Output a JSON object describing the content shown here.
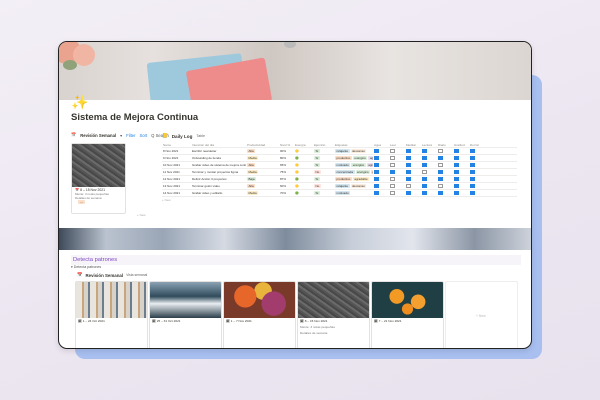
{
  "page": {
    "icon": "✨",
    "title": "Sistema de Mejora Continua"
  },
  "top_view": {
    "name": "Revisión Semanal",
    "filter": "Filter",
    "sort": "Sort",
    "search": "Q Search",
    "card": {
      "date": "📅 8 – 15 Nov 2021",
      "line1": "Mente: 3 notas pequeñas",
      "line2": "Detalles de semana",
      "tag": "—"
    },
    "add_new": "+ New"
  },
  "daily_log": {
    "title": "Daily Log",
    "view": "Table",
    "columns": [
      "Name",
      "Intención del día",
      "Productividad",
      "Nivel %",
      "Energía",
      "Ejercicio",
      "Etiquetas",
      "Agua",
      "Leer",
      "Meditar",
      "Lectura",
      "Diario",
      "Gratitud",
      "Dormir"
    ],
    "rows": [
      {
        "name": "8 Nov 2021",
        "intent": "Escribir newsletter",
        "prod": "Alta",
        "pct": "90%",
        "energy": "🟡",
        "ex": "Sí",
        "tags": [
          [
            "relajante",
            "#d3e5ef"
          ],
          [
            "descanso",
            "#fbecdd"
          ]
        ],
        "cb": [
          1,
          0,
          1,
          1,
          0,
          1,
          1
        ]
      },
      {
        "name": "9 Nov 2021",
        "intent": "Onboarding de tienda",
        "prod": "Media",
        "pct": "80%",
        "energy": "🟢",
        "ex": "Sí",
        "tags": [
          [
            "productivo",
            "#fadec9"
          ],
          [
            "enérgico",
            "#dbeddb"
          ],
          [
            "agradecido",
            "#e8deee"
          ]
        ],
        "cb": [
          1,
          0,
          1,
          1,
          1,
          1,
          1
        ]
      },
      {
        "name": "10 Nov 2021",
        "intent": "Grabar video de sistema de mejora continua",
        "prod": "Alta",
        "pct": "65%",
        "energy": "🟡",
        "ex": "Sí",
        "tags": [
          [
            "motivado",
            "#d3e5ef"
          ],
          [
            "enérgico",
            "#dbeddb"
          ],
          [
            "agradecido",
            "#e8deee"
          ]
        ],
        "cb": [
          1,
          0,
          1,
          1,
          0,
          1,
          1
        ]
      },
      {
        "name": "11 Nov 2021",
        "intent": "Terminar y montar proyectos figma",
        "prod": "Media",
        "pct": "75%",
        "energy": "🟡",
        "ex": "No",
        "tags": [
          [
            "concentrada",
            "#d3e5ef"
          ],
          [
            "enérgico",
            "#dbeddb"
          ],
          [
            "productivo",
            "#fadec9"
          ]
        ],
        "cb": [
          1,
          1,
          1,
          0,
          1,
          1,
          1
        ]
      },
      {
        "name": "12 Nov 2021",
        "intent": "Definir Acción 3 proyectos",
        "prod": "Baja",
        "pct": "87%",
        "energy": "🟢",
        "ex": "Sí",
        "tags": [
          [
            "productivo",
            "#fadec9"
          ],
          [
            "agradable",
            "#fdecc8"
          ]
        ],
        "cb": [
          1,
          0,
          1,
          1,
          1,
          1,
          1
        ]
      },
      {
        "name": "13 Nov 2021",
        "intent": "Terminar guión video",
        "prod": "Alta",
        "pct": "60%",
        "energy": "🟡",
        "ex": "No",
        "tags": [
          [
            "relajante",
            "#d3e5ef"
          ],
          [
            "descanso",
            "#fbecdd"
          ]
        ],
        "cb": [
          1,
          0,
          0,
          1,
          0,
          1,
          1
        ]
      },
      {
        "name": "14 Nov 2021",
        "intent": "Grabar video y editarlo",
        "prod": "Media",
        "pct": "70%",
        "energy": "🟢",
        "ex": "Sí",
        "tags": [
          [
            "motivado",
            "#d3e5ef"
          ]
        ],
        "cb": [
          1,
          0,
          1,
          1,
          1,
          1,
          1
        ]
      }
    ],
    "add_new": "+ New"
  },
  "section": {
    "title": "Detecta patrones",
    "toggle": "▾ Detecta patrones",
    "view_name": "Revisión Semanal",
    "view_type": "Vista semanal",
    "cards": [
      {
        "caption": "🗓 1 – 24 Oct 2021",
        "pic": "brushes"
      },
      {
        "caption": "🗓 25 – 31 Oct 2021",
        "pic": "wave"
      },
      {
        "caption": "🗓 1 – 7 Nov 2021",
        "pic": "leaves"
      },
      {
        "caption": "🗓 8 – 15 Nov 2021",
        "pic": "road",
        "line1": "Mente: 3 notas pequeñas",
        "line2": "Detalles de semana"
      },
      {
        "caption": "🗓 7 – 21 Nov 2021",
        "pic": "oranges"
      }
    ],
    "add_new": "+ New"
  }
}
